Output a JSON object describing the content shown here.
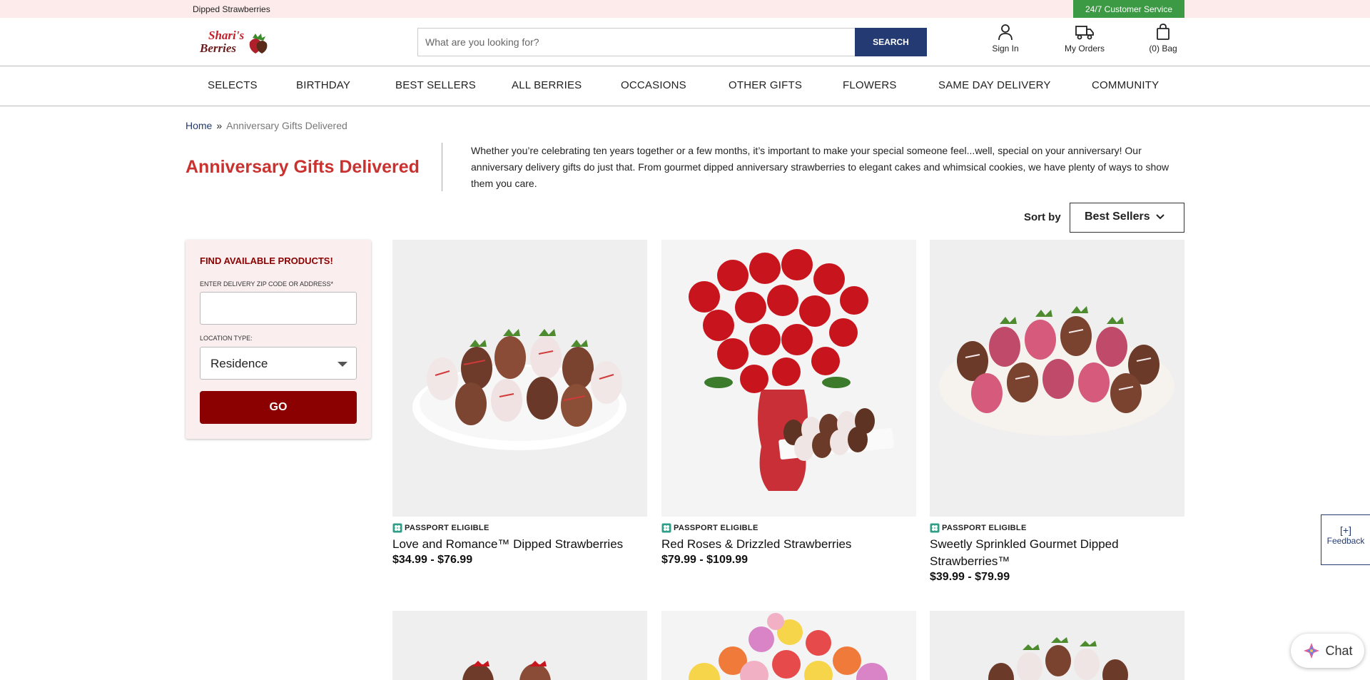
{
  "topbar": {
    "promo": "Dipped Strawberries",
    "customer_service": "24/7 Customer Service",
    "cs_color": "#3c9a45"
  },
  "header": {
    "logo_text_1": "Shari's",
    "logo_text_2": "Berries",
    "search_placeholder": "What are you looking for?",
    "search_button": "SEARCH",
    "sign_in": "Sign In",
    "my_orders": "My Orders",
    "bag": "(0) Bag",
    "icons": [
      "user-icon",
      "truck-icon",
      "bag-icon"
    ]
  },
  "nav": {
    "items": [
      "SELECTS",
      "BIRTHDAY",
      "BEST SELLERS",
      "ALL BERRIES",
      "OCCASIONS",
      "OTHER GIFTS",
      "FLOWERS",
      "SAME DAY DELIVERY",
      "COMMUNITY"
    ]
  },
  "breadcrumb": {
    "home": "Home",
    "separator": "»",
    "current": "Anniversary Gifts Delivered"
  },
  "page": {
    "title": "Anniversary Gifts Delivered",
    "description": "Whether you’re celebrating ten years together or a few months, it’s important to make your special someone feel...well, special on your anniversary! Our anniversary delivery gifts do just that. From gourmet dipped anniversary strawberries to elegant cakes and whimsical cookies, we have plenty of ways to show them you care.",
    "title_color": "#c9322f"
  },
  "sort": {
    "label": "Sort by",
    "value": "Best Sellers"
  },
  "finder": {
    "title": "FIND AVAILABLE PRODUCTS!",
    "zip_label": "ENTER DELIVERY ZIP CODE OR ADDRESS*",
    "zip_value": "",
    "location_label": "LOCATION TYPE:",
    "location_value": "Residence",
    "go_button": "GO"
  },
  "products": [
    {
      "badge": "PASSPORT ELIGIBLE",
      "name": "Love and Romance™ Dipped Strawberries",
      "price": "$34.99 - $76.99"
    },
    {
      "badge": "PASSPORT ELIGIBLE",
      "name": "Red Roses & Drizzled Strawberries",
      "price": "$79.99 - $109.99"
    },
    {
      "badge": "PASSPORT ELIGIBLE",
      "name": "Sweetly Sprinkled Gourmet Dipped Strawberries™",
      "price": "$39.99 - $79.99"
    }
  ],
  "widgets": {
    "feedback_icon": "[+]",
    "feedback": "Feedback",
    "chat": "Chat"
  },
  "colors": {
    "brand_navy": "#233a73",
    "brand_maroon": "#8b0000",
    "topbar_pink": "#fdeaea"
  }
}
